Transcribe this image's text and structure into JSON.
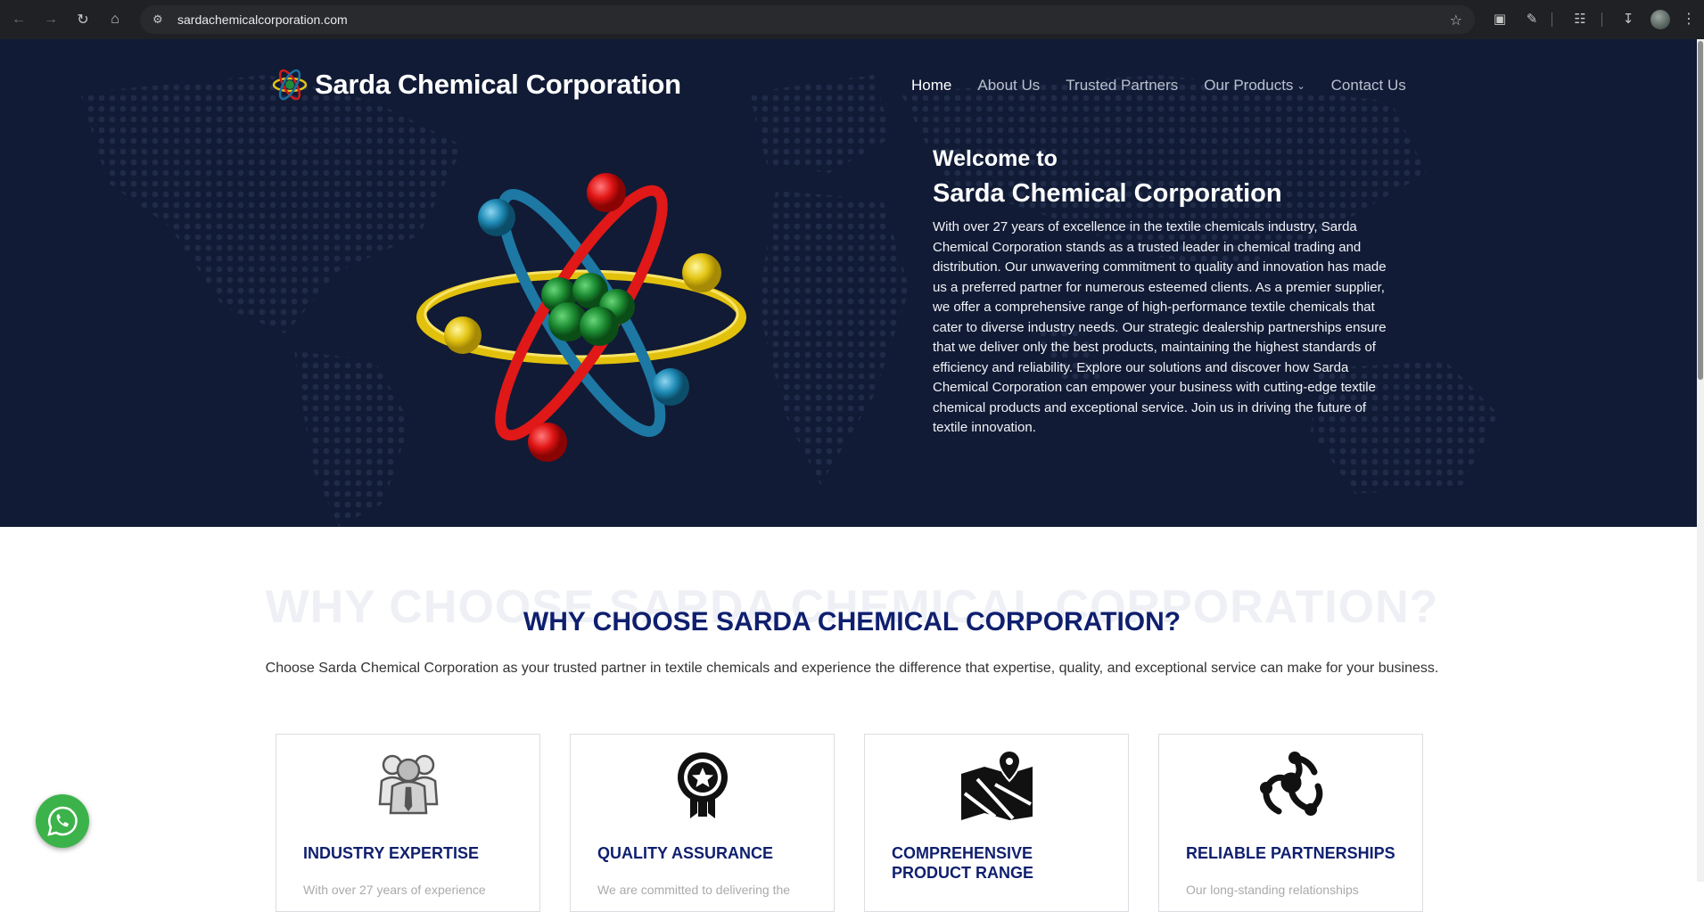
{
  "browser": {
    "url": "sardachemicalcorporation.com",
    "icons": [
      "back-icon",
      "forward-icon",
      "reload-icon",
      "home-icon",
      "site-info-icon",
      "bookmark-star-icon",
      "screenshot-icon",
      "extensions-icon",
      "tab-search-icon",
      "download-icon",
      "profile-avatar",
      "menu-icon"
    ]
  },
  "header": {
    "brand": "Sarda Chemical Corporation",
    "nav": [
      {
        "label": "Home",
        "active": true
      },
      {
        "label": "About Us"
      },
      {
        "label": "Trusted Partners"
      },
      {
        "label": "Our Products",
        "dropdown": true
      },
      {
        "label": "Contact Us"
      }
    ]
  },
  "hero": {
    "welcome_line1": "Welcome to",
    "welcome_line2": "Sarda Chemical Corporation",
    "description": "With over 27 years of excellence in the textile chemicals industry, Sarda Chemical Corporation stands as a trusted leader in chemical trading and distribution. Our unwavering commitment to quality and innovation has made us a preferred partner for numerous esteemed clients. As a premier supplier, we offer a comprehensive range of high-performance textile chemicals that cater to diverse industry needs. Our strategic dealership partnerships ensure that we deliver only the best products, maintaining the highest standards of efficiency and reliability. Explore our solutions and discover how Sarda Chemical Corporation can empower your business with cutting-edge textile chemical products and exceptional service. Join us in driving the future of textile innovation."
  },
  "why": {
    "ghost_title": "WHY CHOOSE SARDA CHEMICAL CORPORATION?",
    "title": "WHY CHOOSE SARDA CHEMICAL CORPORATION?",
    "subtitle": "Choose Sarda Chemical Corporation as your trusted partner in textile chemicals and experience the difference that expertise, quality, and exceptional service can make for your business.",
    "cards": [
      {
        "title": "INDUSTRY EXPERTISE",
        "icon": "team-icon",
        "text": "With over 27 years of experience"
      },
      {
        "title": "QUALITY ASSURANCE",
        "icon": "award-badge-icon",
        "text": "We are committed to delivering the"
      },
      {
        "title": "COMPREHENSIVE PRODUCT RANGE",
        "icon": "map-pin-icon",
        "text": ""
      },
      {
        "title": "RELIABLE PARTNERSHIPS",
        "icon": "network-icon",
        "text": "Our long-standing relationships"
      }
    ]
  },
  "floating": {
    "whatsapp_icon": "whatsapp-icon"
  },
  "colors": {
    "hero_bg": "#111b35",
    "accent_navy": "#0f1f6e",
    "whatsapp": "#3cb34a"
  }
}
